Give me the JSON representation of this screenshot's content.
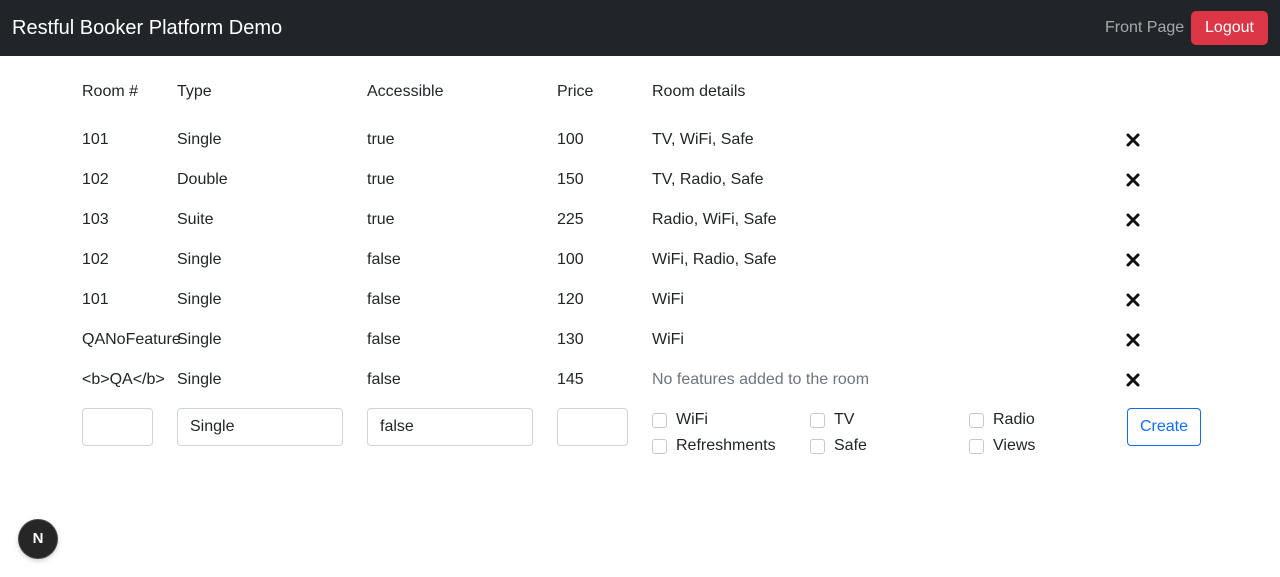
{
  "navbar": {
    "brand": "Restful Booker Platform Demo",
    "front_page_link": "Front Page",
    "logout_label": "Logout"
  },
  "table": {
    "headers": [
      "Room #",
      "Type",
      "Accessible",
      "Price",
      "Room details"
    ],
    "rows": [
      {
        "room": "101",
        "type": "Single",
        "accessible": "true",
        "price": "100",
        "details": "TV, WiFi, Safe"
      },
      {
        "room": "102",
        "type": "Double",
        "accessible": "true",
        "price": "150",
        "details": "TV, Radio, Safe"
      },
      {
        "room": "103",
        "type": "Suite",
        "accessible": "true",
        "price": "225",
        "details": "Radio, WiFi, Safe"
      },
      {
        "room": "102",
        "type": "Single",
        "accessible": "false",
        "price": "100",
        "details": "WiFi, Radio, Safe"
      },
      {
        "room": "101",
        "type": "Single",
        "accessible": "false",
        "price": "120",
        "details": "WiFi"
      },
      {
        "room": "QANoFeature",
        "type": "Single",
        "accessible": "false",
        "price": "130",
        "details": "WiFi"
      },
      {
        "room": "<b>QA</b>",
        "type": "Single",
        "accessible": "false",
        "price": "145",
        "details": "No features added to the room"
      }
    ]
  },
  "form": {
    "room_value": "",
    "type_value": "Single",
    "accessible_value": "false",
    "price_value": "",
    "features": [
      {
        "label": "WiFi",
        "checked": false
      },
      {
        "label": "TV",
        "checked": false
      },
      {
        "label": "Radio",
        "checked": false
      },
      {
        "label": "Refreshments",
        "checked": false
      },
      {
        "label": "Safe",
        "checked": false
      },
      {
        "label": "Views",
        "checked": false
      }
    ],
    "create_label": "Create"
  },
  "dev_badge": "N"
}
